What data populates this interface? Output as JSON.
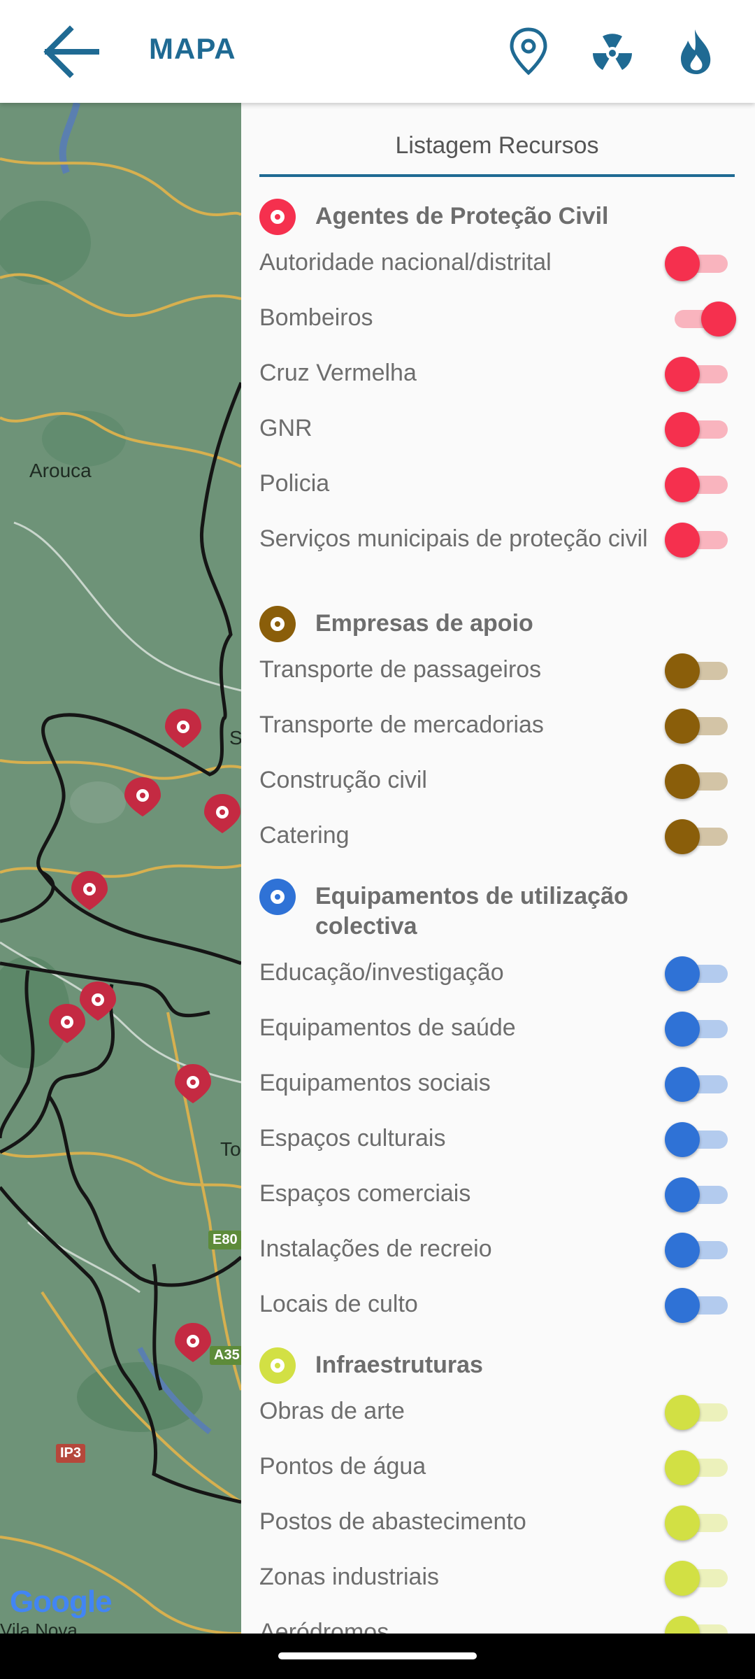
{
  "appbar": {
    "title": "MAPA",
    "colors": {
      "primary": "#1f6a93"
    }
  },
  "map": {
    "labels": {
      "arouca": "Arouca",
      "s": "S",
      "to": "To"
    },
    "shields": {
      "e80": "E80",
      "a35": "A35",
      "ip3": "IP3"
    },
    "google": "Google",
    "bottom_label": "Vila Nova"
  },
  "panel": {
    "title": "Listagem Recursos",
    "sections": [
      {
        "title": "Agentes de Proteção Civil",
        "color": "#f5304e",
        "items": [
          {
            "label": "Autoridade nacional/distrital",
            "on": false
          },
          {
            "label": "Bombeiros",
            "on": true
          },
          {
            "label": "Cruz Vermelha",
            "on": false
          },
          {
            "label": "GNR",
            "on": false
          },
          {
            "label": "Policia",
            "on": false
          },
          {
            "label": "Serviços municipais de proteção civil",
            "on": false
          }
        ]
      },
      {
        "title": "Empresas de apoio",
        "color": "#8a5e0a",
        "items": [
          {
            "label": "Transporte de passageiros",
            "on": false
          },
          {
            "label": "Transporte de mercadorias",
            "on": false
          },
          {
            "label": "Construção civil",
            "on": false
          },
          {
            "label": "Catering",
            "on": false
          }
        ]
      },
      {
        "title": "Equipamentos de utilização colectiva",
        "color": "#2f72d6",
        "items": [
          {
            "label": "Educação/investigação",
            "on": false
          },
          {
            "label": "Equipamentos de saúde",
            "on": false
          },
          {
            "label": "Equipamentos sociais",
            "on": false
          },
          {
            "label": "Espaços culturais",
            "on": false
          },
          {
            "label": "Espaços comerciais",
            "on": false
          },
          {
            "label": "Instalações de recreio",
            "on": false
          },
          {
            "label": "Locais de culto",
            "on": false
          }
        ]
      },
      {
        "title": "Infraestruturas",
        "color": "#d2e044",
        "items": [
          {
            "label": "Obras de arte",
            "on": false
          },
          {
            "label": "Pontos de água",
            "on": false
          },
          {
            "label": "Postos de abastecimento",
            "on": false
          },
          {
            "label": "Zonas industriais",
            "on": false
          },
          {
            "label": "Aeródromos",
            "on": false
          }
        ]
      }
    ]
  },
  "icons": {
    "back": "arrow-left-icon",
    "location": "map-pin-icon",
    "radiation": "radiation-icon",
    "fire": "flame-icon"
  }
}
